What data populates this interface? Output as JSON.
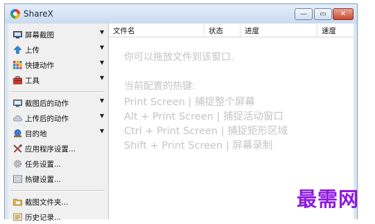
{
  "window": {
    "title": "ShareX",
    "minimize_glyph": "—",
    "maximize_glyph": "▭",
    "close_glyph": "✕"
  },
  "menu": {
    "items": [
      {
        "label": "屏幕截图",
        "icon": "monitor-capture-icon",
        "has_submenu": true
      },
      {
        "label": "上传",
        "icon": "upload-arrow-icon",
        "has_submenu": true
      },
      {
        "label": "快捷动作",
        "icon": "grid-icon",
        "has_submenu": true
      },
      {
        "label": "工具",
        "icon": "toolbox-icon",
        "has_submenu": true
      },
      {
        "label": "截图后的动作",
        "icon": "after-capture-icon",
        "has_submenu": true
      },
      {
        "label": "上传后的动作",
        "icon": "cloud-icon",
        "has_submenu": true
      },
      {
        "label": "目的地",
        "icon": "destination-icon",
        "has_submenu": true
      },
      {
        "label": "应用程序设置...",
        "icon": "wrench-icon",
        "has_submenu": false
      },
      {
        "label": "任务设置...",
        "icon": "gear-icon",
        "has_submenu": false
      },
      {
        "label": "热键设置...",
        "icon": "keyboard-icon",
        "has_submenu": false
      },
      {
        "label": "截图文件夹...",
        "icon": "folder-icon",
        "has_submenu": false
      },
      {
        "label": "历史记录...",
        "icon": "history-icon",
        "has_submenu": false
      }
    ],
    "submenu_arrow": "▼"
  },
  "list": {
    "columns": [
      "文件名",
      "状态",
      "进度",
      "速度"
    ],
    "hint_drop": "你可以拖放文件到该窗口.",
    "hint_hotkeys_title": "当前配置的热键:",
    "hotkeys": [
      "Print Screen  |  捕捉整个屏幕",
      "Alt + Print Screen  |  捕捉活动窗口",
      "Ctrl + Print Screen  |  捕捉矩形区域",
      "Shift + Print Screen  |  屏幕录制"
    ]
  },
  "watermark": "最需网",
  "colors": {
    "accent": "#2f7ce0",
    "close": "#c74a32",
    "watermark": "#8e1ae0",
    "hint_text": "#c4c4c4"
  }
}
